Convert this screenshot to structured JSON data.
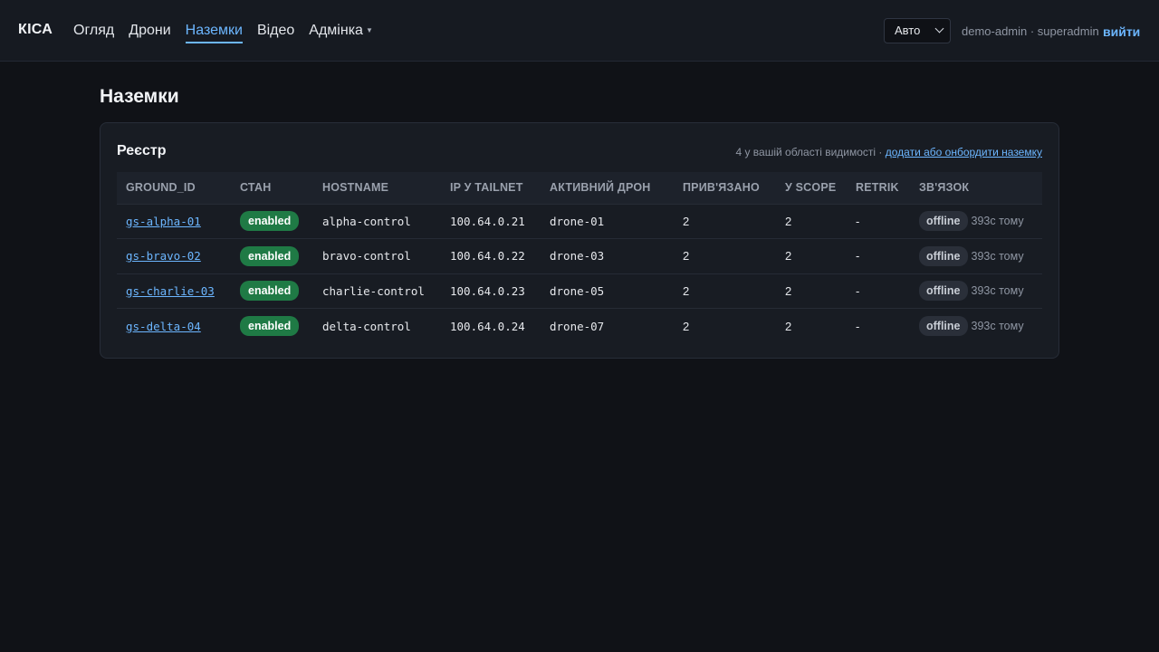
{
  "header": {
    "brand": "КІСА",
    "nav": [
      {
        "label": "Огляд"
      },
      {
        "label": "Дрони"
      },
      {
        "label": "Наземки"
      },
      {
        "label": "Відео"
      },
      {
        "label": "Адмінка"
      }
    ],
    "active_nav": "Наземки",
    "mode_select": {
      "value": "Авто"
    },
    "user": "demo-admin · superadmin",
    "logout": "вийти"
  },
  "page": {
    "title": "Наземки"
  },
  "registry": {
    "title": "Реєстр",
    "meta_text": "4 у вашій області видимості · ",
    "meta_link": "додати або онбордити наземку",
    "columns": [
      "GROUND_ID",
      "СТАН",
      "HOSTNAME",
      "IP У TAILNET",
      "АКТИВНИЙ ДРОН",
      "ПРИВ'ЯЗАНО",
      "У SCOPE",
      "RETRIK",
      "ЗВ'ЯЗОК"
    ],
    "rows": [
      {
        "ground_id": "gs-alpha-01",
        "state": "enabled",
        "hostname": "alpha-control",
        "ip": "100.64.0.21",
        "drone": "drone-01",
        "bound": "2",
        "scope": "2",
        "retrik": "-",
        "link": "offline",
        "ago": "393с тому"
      },
      {
        "ground_id": "gs-bravo-02",
        "state": "enabled",
        "hostname": "bravo-control",
        "ip": "100.64.0.22",
        "drone": "drone-03",
        "bound": "2",
        "scope": "2",
        "retrik": "-",
        "link": "offline",
        "ago": "393с тому"
      },
      {
        "ground_id": "gs-charlie-03",
        "state": "enabled",
        "hostname": "charlie-control",
        "ip": "100.64.0.23",
        "drone": "drone-05",
        "bound": "2",
        "scope": "2",
        "retrik": "-",
        "link": "offline",
        "ago": "393с тому"
      },
      {
        "ground_id": "gs-delta-04",
        "state": "enabled",
        "hostname": "delta-control",
        "ip": "100.64.0.24",
        "drone": "drone-07",
        "bound": "2",
        "scope": "2",
        "retrik": "-",
        "link": "offline",
        "ago": "393с тому"
      }
    ]
  },
  "colors": {
    "accent": "#6cb6ff",
    "enabled_badge": "#1f7a45",
    "background": "#101217"
  },
  "icons": {
    "mode_select_chevron": "chevron-down-icon",
    "admin_caret": "caret-down-icon"
  }
}
